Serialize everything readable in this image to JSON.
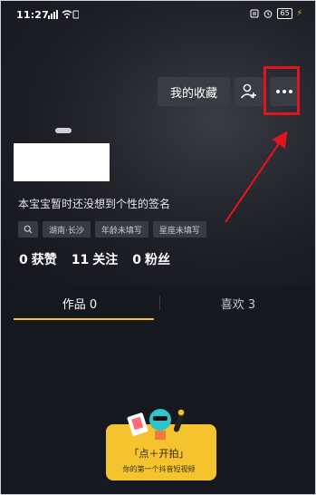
{
  "status_bar": {
    "time": "11:27",
    "battery": "65"
  },
  "header": {
    "favorites_label": "我的收藏",
    "add_friend_icon": "add-user-icon",
    "more_icon": "more-dots-icon"
  },
  "profile": {
    "signature": "本宝宝暂时还没想到个性的签名",
    "tags": [
      {
        "icon": "search-icon"
      },
      {
        "label": "湖南·长沙"
      },
      {
        "label": "年龄未填写"
      },
      {
        "label": "星座未填写"
      }
    ],
    "stats": [
      {
        "value": "0",
        "label": "获赞"
      },
      {
        "value": "11",
        "label": "关注"
      },
      {
        "value": "0",
        "label": "粉丝"
      }
    ]
  },
  "tabs": [
    {
      "label": "作品 0",
      "active": true
    },
    {
      "label": "喜欢 3",
      "active": false
    }
  ],
  "promo": {
    "title": "「点＋开拍」",
    "subtitle": "你的第一个抖音短视频"
  },
  "colors": {
    "accent": "#f4c32d",
    "highlight": "#e0141f",
    "background": "#16181f",
    "button_bg": "#3a3c44"
  }
}
